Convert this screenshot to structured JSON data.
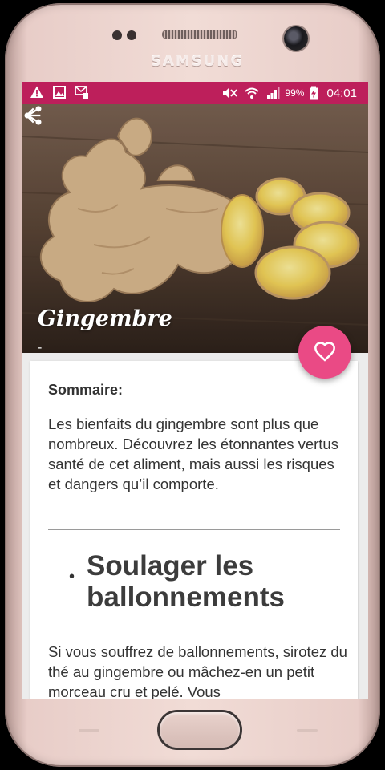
{
  "device": {
    "brand": "SAMSUNG"
  },
  "statusbar": {
    "left_icons": [
      "warning-icon",
      "image-icon",
      "sms-icon"
    ],
    "right_icons": [
      "mute-icon",
      "wifi-icon",
      "signal-icon",
      "battery-charging-icon"
    ],
    "battery": "99%",
    "time": "04:01"
  },
  "header": {
    "title": "Gingembre",
    "subtitle": "-",
    "back_icon": "arrow-back-icon",
    "share_icon": "share-icon"
  },
  "fab": {
    "icon": "heart-outline-icon",
    "color": "#ea4a85"
  },
  "article": {
    "summary_label": "Sommaire:",
    "summary_text": "Les bienfaits du gingembre sont plus que nombreux. Découvrez les étonnantes vertus santé de cet aliment, mais aussi les risques et dangers qu’il comporte.",
    "bullet": "•",
    "section_heading": "Soulager les ballonnements",
    "section_text": "Si vous souffrez de ballonnements, sirotez du thé au gingembre ou mâchez-en un petit morceau cru et pelé. Vous"
  },
  "colors": {
    "accent": "#bd1f5b",
    "fab": "#ea4a85"
  }
}
